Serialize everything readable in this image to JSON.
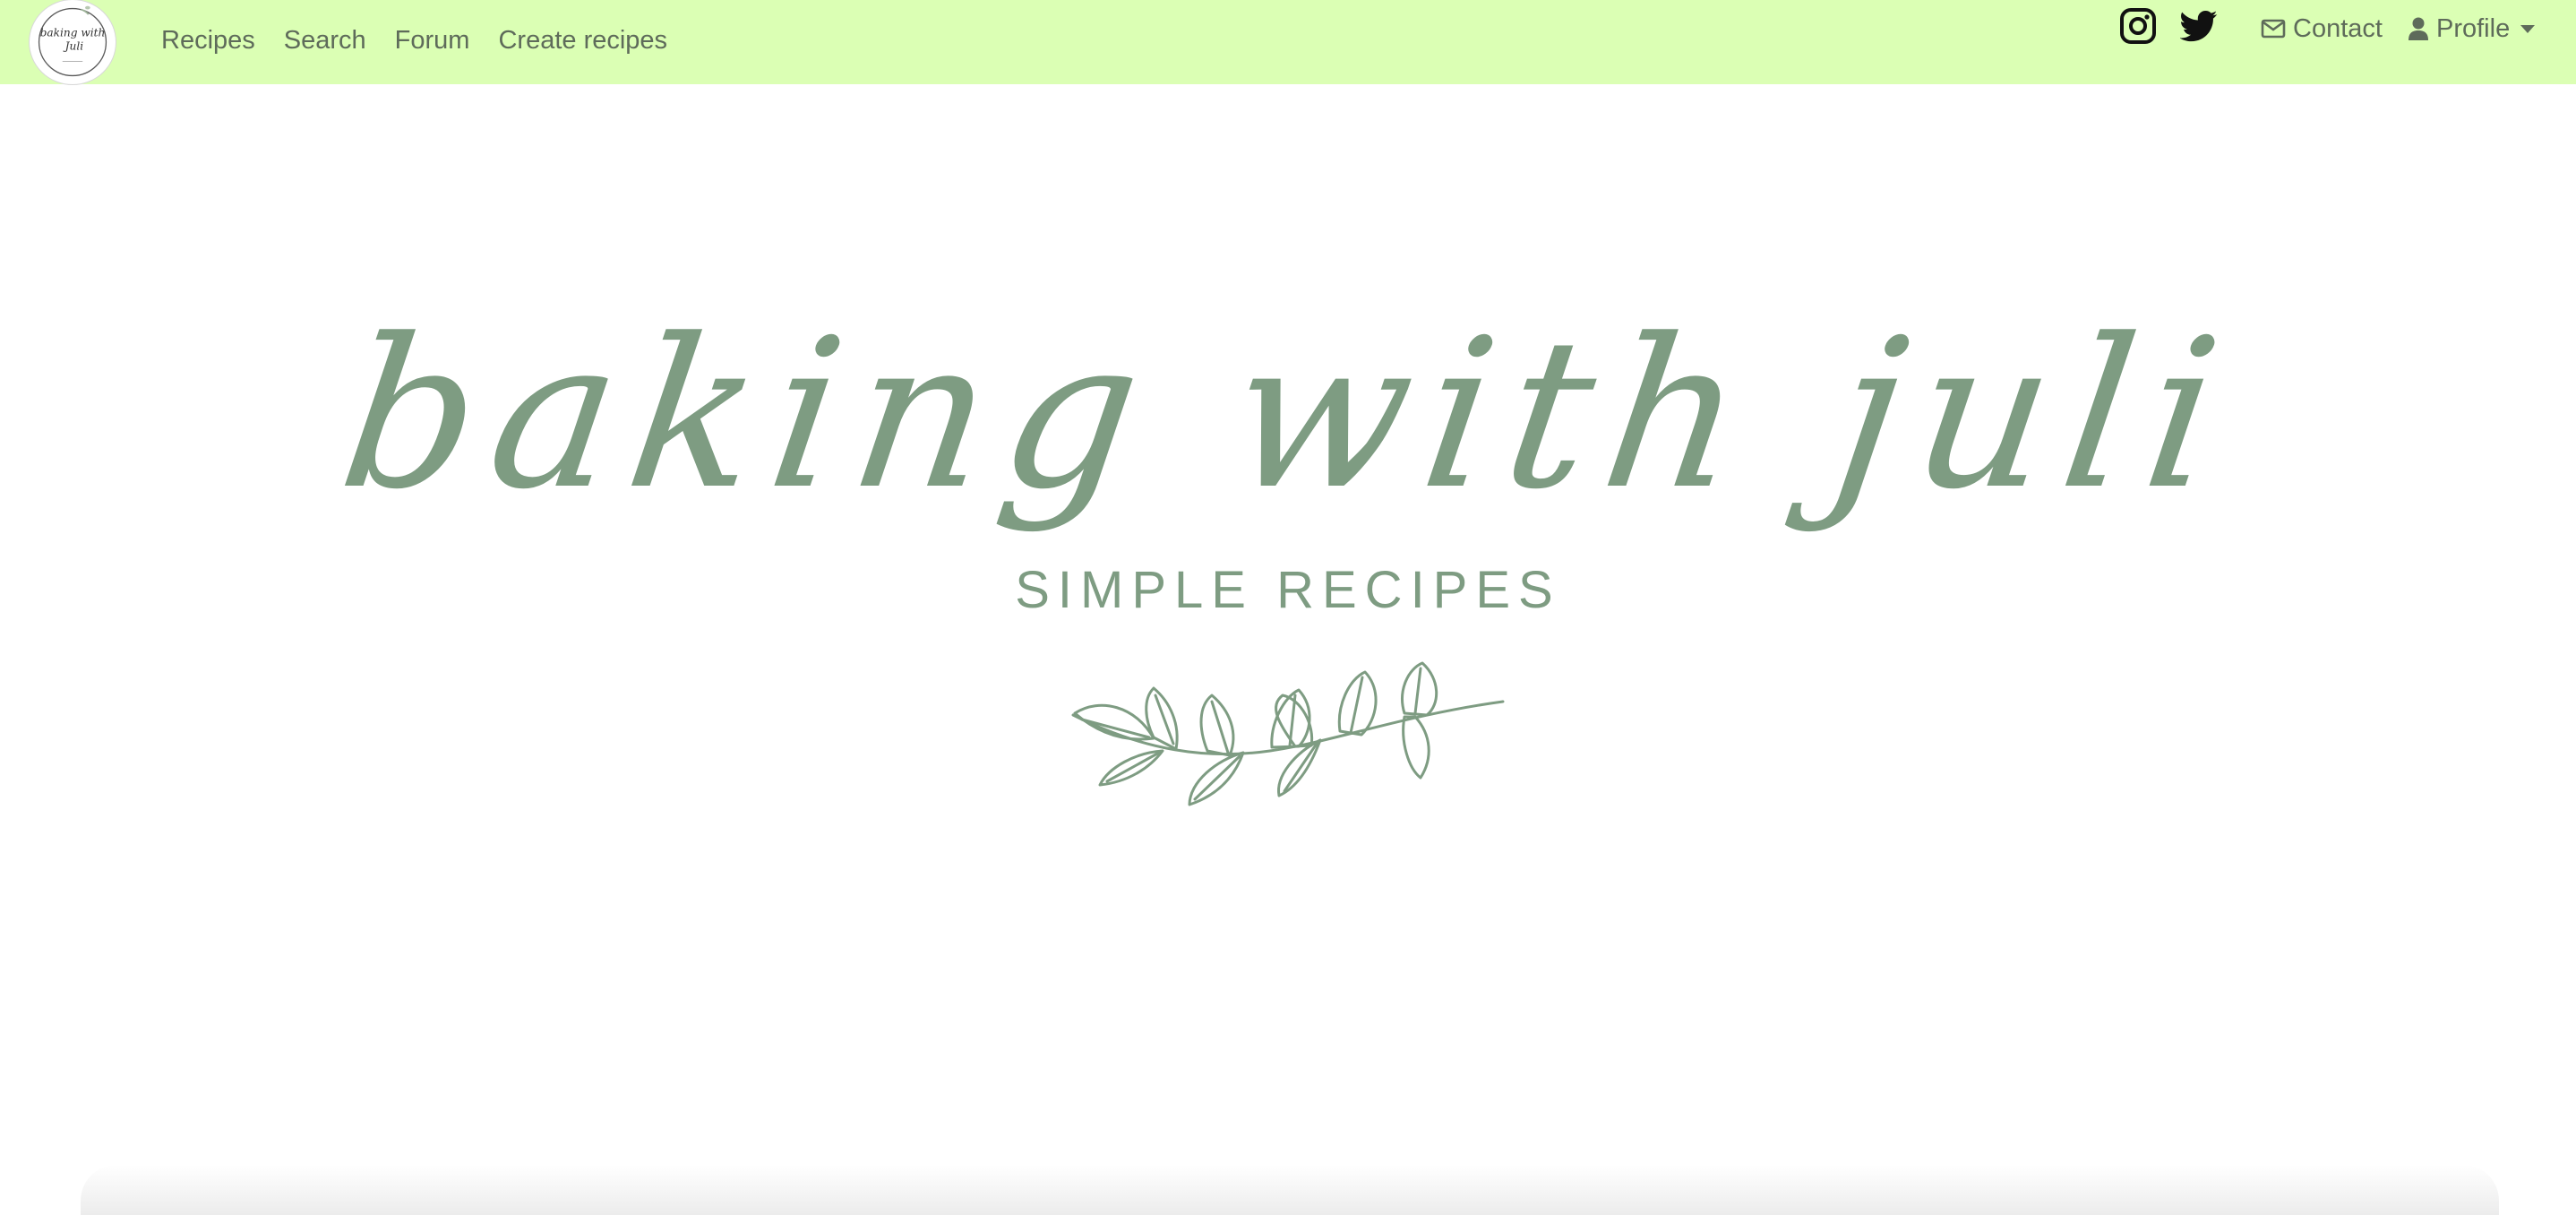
{
  "nav": {
    "brand_logo": {
      "icon": "baking-with-juli-logo",
      "lines": [
        "baking with",
        "Juli"
      ]
    },
    "links": [
      "Recipes",
      "Search",
      "Forum",
      "Create recipes"
    ],
    "social": [
      {
        "icon": "instagram-icon"
      },
      {
        "icon": "twitter-icon"
      }
    ],
    "contact": {
      "label": "Contact",
      "icon": "envelope-icon"
    },
    "profile": {
      "label": "Profile",
      "icon": "user-icon"
    }
  },
  "hero": {
    "script_text": "baking with juli",
    "subtitle": "SIMPLE RECIPES",
    "decoration": "leaf-sprig-icon"
  },
  "colors": {
    "navbar_bg": "#dbffb4",
    "nav_text": "#5e6b5a",
    "accent": "#7e9c82"
  }
}
